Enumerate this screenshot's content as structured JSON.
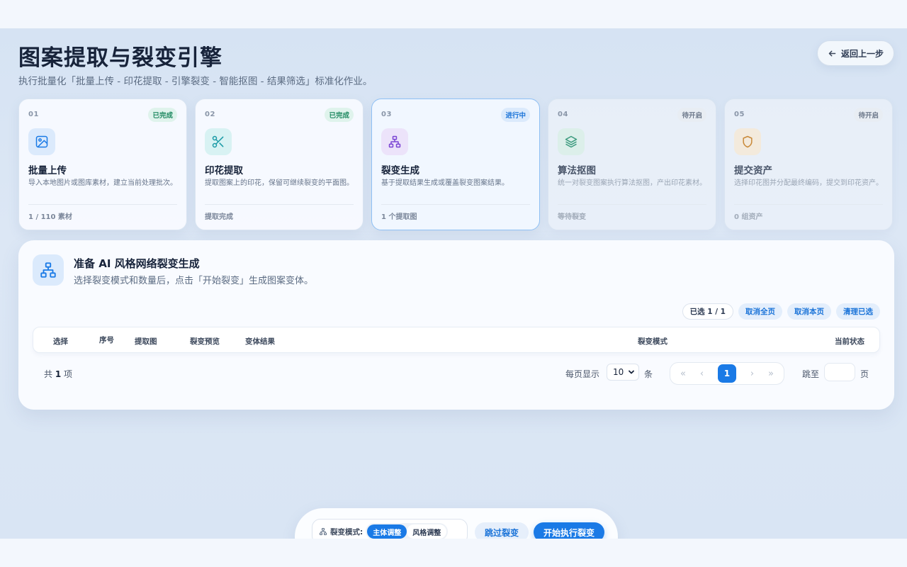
{
  "header": {
    "title": "图案提取与裂变引擎",
    "subtitle": "执行批量化「批量上传 - 印花提取 - 引擎裂变 - 智能抠图 - 结果筛选」标准化作业。",
    "back_label": "返回上一步"
  },
  "steps": [
    {
      "num": "01",
      "status": "已完成",
      "status_type": "done",
      "icon": "image-icon",
      "title": "批量上传",
      "desc": "导入本地图片或图库素材，建立当前处理批次。",
      "footer": "1 / 110 素材"
    },
    {
      "num": "02",
      "status": "已完成",
      "status_type": "done",
      "icon": "scissors-icon",
      "title": "印花提取",
      "desc": "提取图案上的印花，保留可继续裂变的平面图。",
      "footer": "提取完成"
    },
    {
      "num": "03",
      "status": "进行中",
      "status_type": "progress",
      "icon": "network-icon",
      "title": "裂变生成",
      "desc": "基于提取结果生成或覆盖裂变图案结果。",
      "footer": "1 个提取图"
    },
    {
      "num": "04",
      "status": "待开启",
      "status_type": "wait",
      "icon": "layers-icon",
      "title": "算法抠图",
      "desc": "统一对裂变图案执行算法抠图，产出印花素材。",
      "footer": "等待裂变"
    },
    {
      "num": "05",
      "status": "待开启",
      "status_type": "wait",
      "icon": "shield-icon",
      "title": "提交资产",
      "desc": "选择印花图并分配最终编码，提交到印花资产。",
      "footer": "0 组资产"
    }
  ],
  "panel": {
    "title": "准备 AI 风格网络裂变生成",
    "subtitle": "选择裂变模式和数量后，点击「开始裂变」生成图案变体。",
    "selected_label": "已选 1 / 1",
    "actions": [
      "取消全页",
      "取消本页",
      "清理已选"
    ],
    "columns": [
      "选择",
      "序号",
      "提取图",
      "裂变预览",
      "变体结果",
      "裂变模式",
      "当前状态"
    ]
  },
  "pagination": {
    "total_prefix": "共",
    "total_count": "1",
    "total_suffix": "项",
    "per_page_label": "每页显示",
    "per_page_value": "10",
    "per_page_unit": "条",
    "current_page": "1",
    "first": "«",
    "prev": "‹",
    "next": "›",
    "last": "»",
    "jump_label": "跳至",
    "jump_unit": "页"
  },
  "bottom": {
    "mode_label": "裂变模式:",
    "mode_options": [
      "主体调整",
      "风格调整"
    ],
    "selected_mode": "主体调整",
    "skip_label": "跳过裂变",
    "start_label": "开始执行裂变"
  }
}
